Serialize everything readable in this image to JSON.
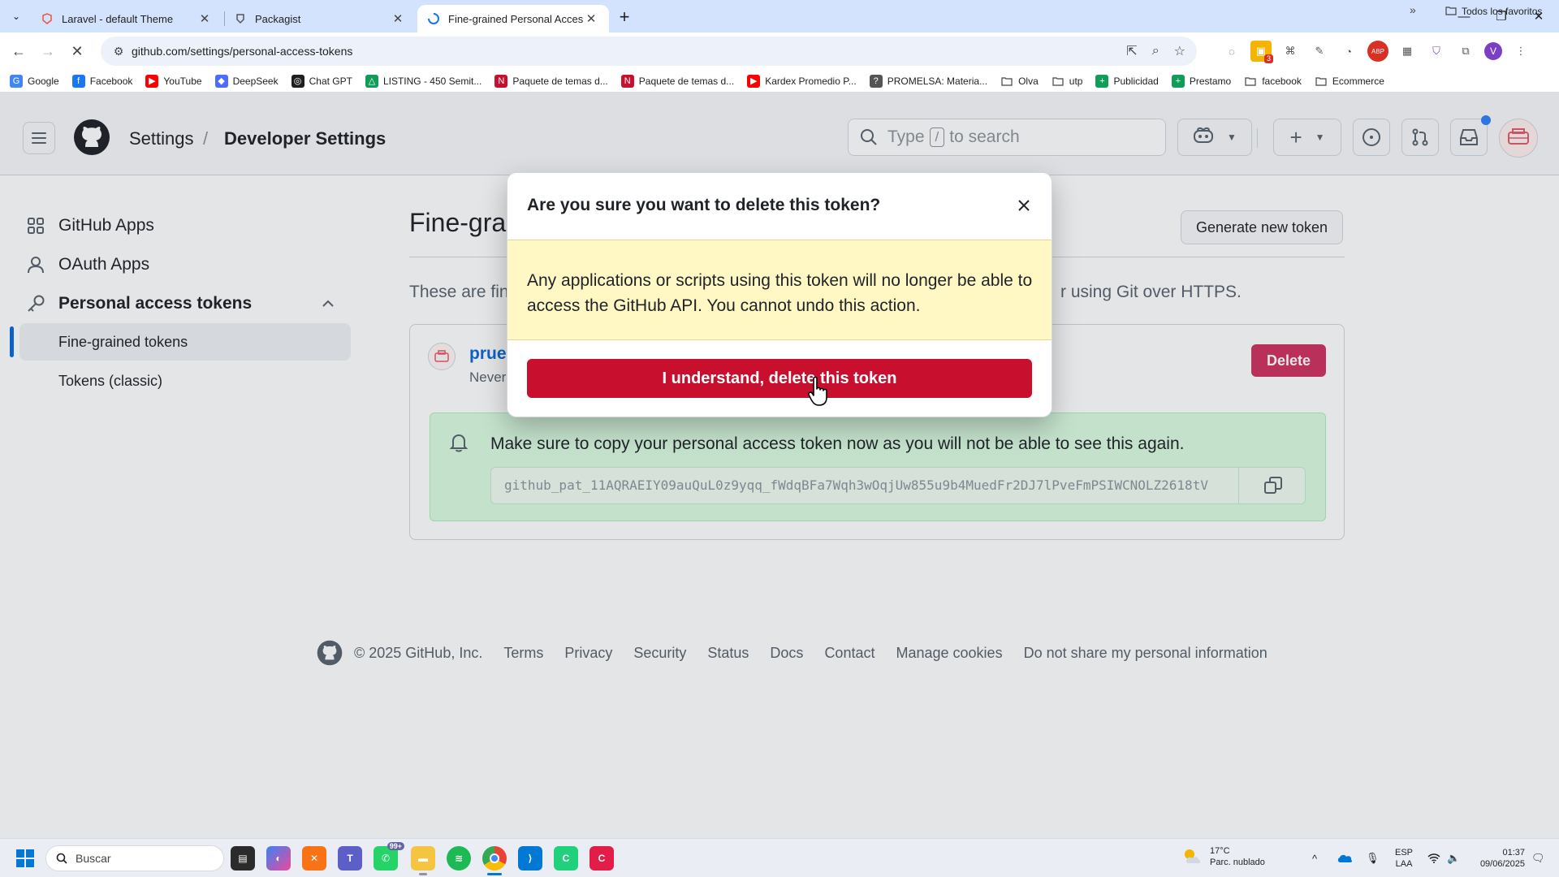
{
  "browser": {
    "tabs": [
      {
        "title": "Laravel - default Theme",
        "icon": "laravel-icon"
      },
      {
        "title": "Packagist",
        "icon": "packagist-icon"
      },
      {
        "title": "Fine-grained Personal Access To",
        "icon": "loading-icon"
      }
    ],
    "url": "github.com/settings/personal-access-tokens",
    "bookmarks": [
      {
        "label": "Google",
        "color": "#4285f4",
        "glyph": "G"
      },
      {
        "label": "Facebook",
        "color": "#1877f2",
        "glyph": "f"
      },
      {
        "label": "YouTube",
        "color": "#ff0000",
        "glyph": "▶"
      },
      {
        "label": "DeepSeek",
        "color": "#4d6bfe",
        "glyph": "◆"
      },
      {
        "label": "Chat GPT",
        "color": "#1f1f1f",
        "glyph": "◎"
      },
      {
        "label": "LISTING - 450 Semit...",
        "color": "#0f9d58",
        "glyph": "△"
      },
      {
        "label": "Paquete de temas d...",
        "color": "#c8102e",
        "glyph": "N"
      },
      {
        "label": "Paquete de temas d...",
        "color": "#c8102e",
        "glyph": "N"
      },
      {
        "label": "Kardex Promedio P...",
        "color": "#ff0000",
        "glyph": "▶"
      },
      {
        "label": "PROMELSA: Materia...",
        "color": "#555555",
        "glyph": "?"
      },
      {
        "label": "Olva",
        "color": "folder",
        "glyph": ""
      },
      {
        "label": "utp",
        "color": "folder",
        "glyph": ""
      },
      {
        "label": "Publicidad",
        "color": "#0f9d58",
        "glyph": "+"
      },
      {
        "label": "Prestamo",
        "color": "#0f9d58",
        "glyph": "+"
      },
      {
        "label": "facebook",
        "color": "folder",
        "glyph": ""
      },
      {
        "label": "Ecommerce",
        "color": "folder",
        "glyph": ""
      }
    ],
    "all_bookmarks": "Todos los favoritos",
    "ext_badge": "3"
  },
  "header": {
    "crumb_settings": "Settings",
    "crumb_sep": "/",
    "crumb_developer": "Developer Settings",
    "search_prefix": "Type",
    "search_key": "/",
    "search_suffix": "to search"
  },
  "sidebar": {
    "github_apps": "GitHub Apps",
    "oauth_apps": "OAuth Apps",
    "personal_tokens": "Personal access tokens",
    "fine_grained": "Fine-grained tokens",
    "classic": "Tokens (classic)"
  },
  "main": {
    "title": "Fine-grai",
    "generate_button": "Generate new token",
    "desc_left": "These are fin",
    "desc_right": "r using Git over HTTPS.",
    "token_name": "prue",
    "token_expiry": "Never",
    "delete_button": "Delete",
    "flash_message": "Make sure to copy your personal access token now as you will not be able to see this again.",
    "token_value": "github_pat_11AQRAEIY09auQuL0z9yqq_fWdqBFa7Wqh3wOqjUw855u9b4MuedFr2DJ7lPveFmPSIWCNOLZ2618tV"
  },
  "dialog": {
    "title": "Are you sure you want to delete this token?",
    "warning": "Any applications or scripts using this token will no longer be able to access the GitHub API. You cannot undo this action.",
    "confirm_button": "I understand, delete this token"
  },
  "footer": {
    "copyright": "© 2025 GitHub, Inc.",
    "links": [
      "Terms",
      "Privacy",
      "Security",
      "Status",
      "Docs",
      "Contact",
      "Manage cookies",
      "Do not share my personal information"
    ]
  },
  "taskbar": {
    "search_placeholder": "Buscar",
    "teams_badge": "99+",
    "weather_temp": "17°C",
    "weather_desc": "Parc. nublado",
    "lang_top": "ESP",
    "lang_bottom": "LAA",
    "time": "01:37",
    "date": "09/06/2025"
  },
  "colors": {
    "danger": "#c8102e",
    "delete_button": "#cf3361",
    "flash_bg": "#dafbe1",
    "warning_bg": "#fff8c5",
    "accent": "#0969da"
  }
}
